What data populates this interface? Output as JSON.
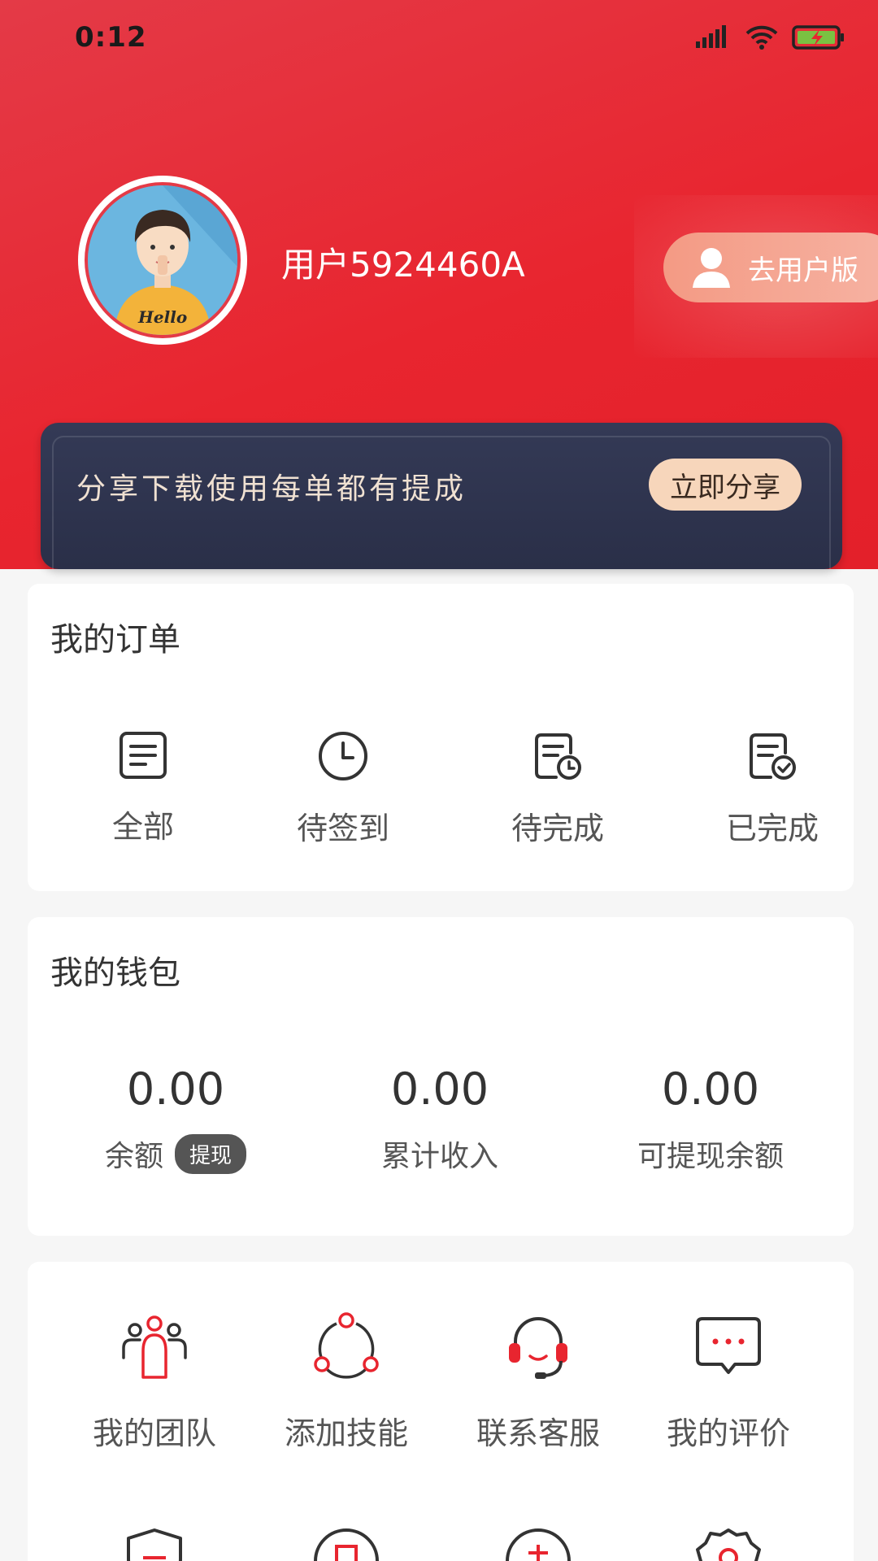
{
  "status_bar": {
    "time": "0:12"
  },
  "profile": {
    "username": "用户5924460A",
    "avatar_caption": "Hello"
  },
  "switch_button": {
    "label": "去用户版"
  },
  "share_banner": {
    "text": "分享下载使用每单都有提成",
    "button_label": "立即分享"
  },
  "orders": {
    "title": "我的订单",
    "items": [
      {
        "label": "全部",
        "icon": "list-icon"
      },
      {
        "label": "待签到",
        "icon": "clock-icon"
      },
      {
        "label": "待完成",
        "icon": "doc-clock-icon"
      },
      {
        "label": "已完成",
        "icon": "doc-check-icon"
      }
    ]
  },
  "wallet": {
    "title": "我的钱包",
    "items": [
      {
        "value": "0.00",
        "label": "余额",
        "badge": "提现"
      },
      {
        "value": "0.00",
        "label": "累计收入"
      },
      {
        "value": "0.00",
        "label": "可提现余额"
      }
    ]
  },
  "tools": {
    "items": [
      {
        "label": "我的团队",
        "icon": "team-icon"
      },
      {
        "label": "添加技能",
        "icon": "skill-network-icon"
      },
      {
        "label": "联系客服",
        "icon": "headset-icon"
      },
      {
        "label": "我的评价",
        "icon": "chat-bubble-icon"
      }
    ],
    "row2_icons": [
      "shield-cert-icon",
      "commission-circle-icon",
      "circle-char-icon",
      "gear-badge-icon"
    ]
  },
  "colors": {
    "brand_red": "#e8252f",
    "banner_dark": "#2f3550",
    "accent_peach": "#f7d6bb"
  }
}
